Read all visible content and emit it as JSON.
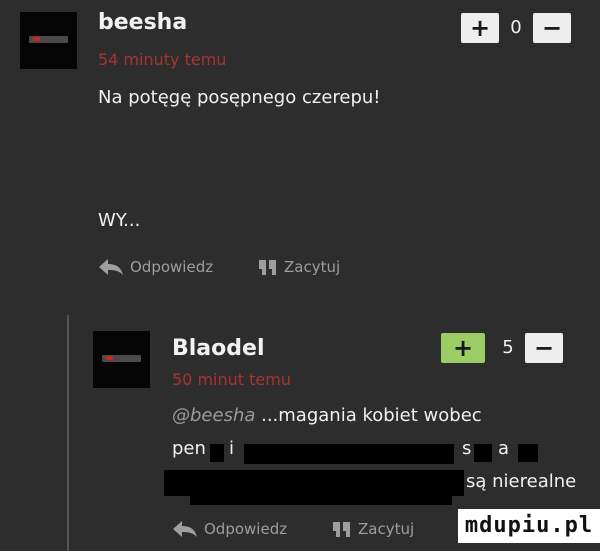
{
  "comments": [
    {
      "username": "beesha",
      "time_ago": "54 minuty temu",
      "body_lines": [
        "Na potęgę posępnego czerepu!",
        "",
        "WY..."
      ],
      "vote_up": "+",
      "score": "0",
      "vote_down": "−",
      "reply_label": "Odpowiedz",
      "quote_label": "Zacytuj"
    },
    {
      "username": "Blaodel",
      "time_ago": "50 minut temu",
      "mention": "@beesha",
      "body_line1": " ...magania kobiet wobec",
      "body_line2_start": "pen",
      "body_line2_mid1": "i",
      "body_line2_mid2": "s",
      "body_line2_mid3": "a",
      "body_line3": "są nierealne",
      "vote_up": "+",
      "score": "5",
      "vote_down": "−",
      "reply_label": "Odpowiedz",
      "quote_label": "Zacytuj"
    }
  ],
  "watermark": "mdupiu.pl",
  "colors": {
    "background": "#2d2d2d",
    "time_ago": "#a83232",
    "vote_active": "#9ccc65"
  },
  "icons": [
    "reply-arrow-icon",
    "quote-icon"
  ]
}
